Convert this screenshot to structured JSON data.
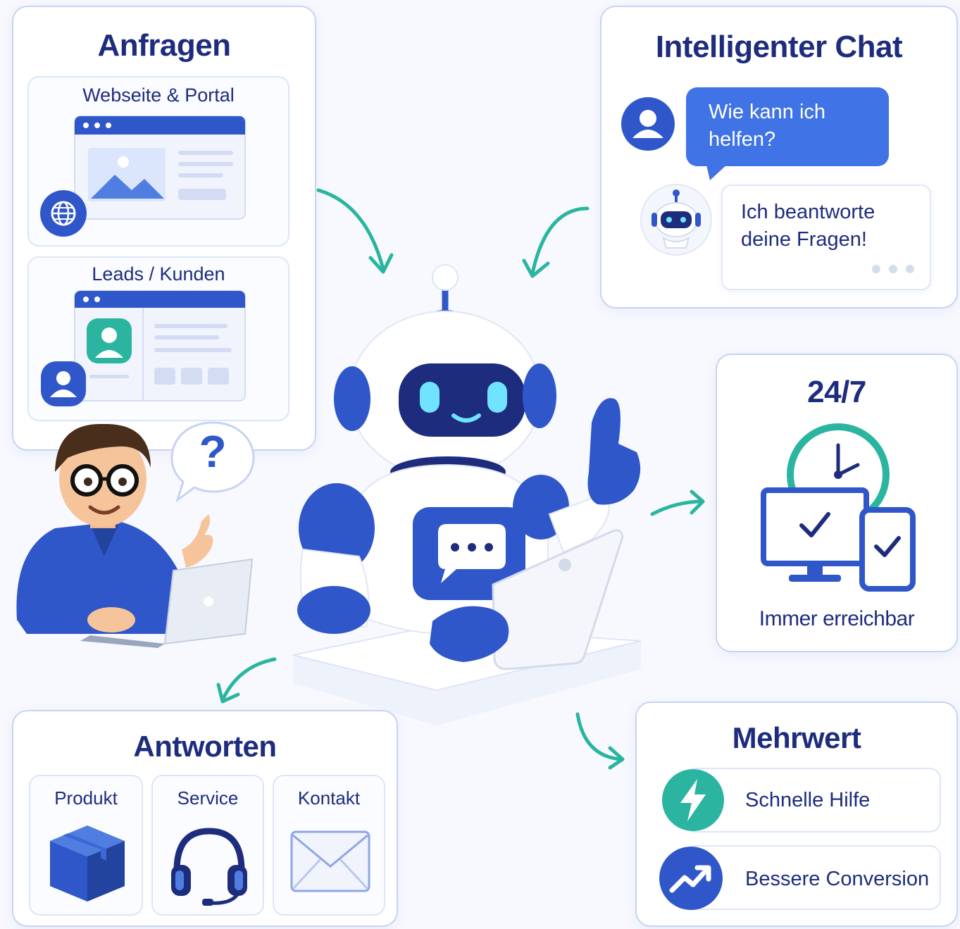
{
  "requests": {
    "title": "Anfragen",
    "website_label": "Webseite & Portal",
    "leads_label": "Leads / Kunden"
  },
  "person": {
    "question_mark": "?"
  },
  "chat": {
    "title": "Intelligenter Chat",
    "user_message": "Wie kann ich helfen?",
    "bot_message": "Ich beantworte deine Fragen!"
  },
  "availability": {
    "title": "24/7",
    "caption": "Immer erreichbar"
  },
  "answers": {
    "title": "Antworten",
    "items": [
      {
        "label": "Produkt",
        "icon": "box-icon"
      },
      {
        "label": "Service",
        "icon": "headset-icon"
      },
      {
        "label": "Kontakt",
        "icon": "envelope-icon"
      }
    ]
  },
  "value": {
    "title": "Mehrwert",
    "items": [
      {
        "label": "Schnelle Hilfe",
        "icon": "lightning-icon"
      },
      {
        "label": "Bessere Conversion",
        "icon": "trend-up-icon"
      }
    ]
  },
  "colors": {
    "primary": "#2f57c9",
    "navy": "#1e2c7d",
    "teal": "#2bb5a0",
    "border": "#c7d3f3",
    "chat_blue": "#3f73e6"
  }
}
